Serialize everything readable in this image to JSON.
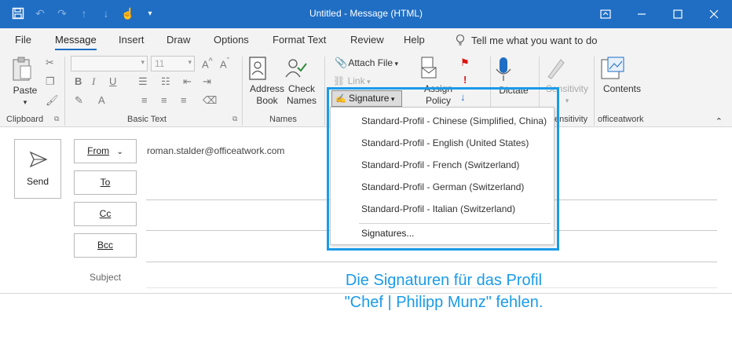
{
  "titlebar": {
    "title": "Untitled  -  Message (HTML)",
    "qat_icons": [
      "save-icon",
      "undo-icon",
      "redo-icon",
      "up-arrow-icon",
      "down-arrow-icon",
      "touch-mode-icon",
      "customize-qat-icon"
    ],
    "window_controls": [
      "ribbon-display-icon",
      "minimize-icon",
      "maximize-icon",
      "close-icon"
    ]
  },
  "tabs": [
    "File",
    "Message",
    "Insert",
    "Draw",
    "Options",
    "Format Text",
    "Review",
    "Help"
  ],
  "active_tab": "Message",
  "tell_me": "Tell me what you want to do",
  "ribbon": {
    "clipboard": {
      "paste": "Paste",
      "label": "Clipboard"
    },
    "basic_text": {
      "font_size": "11",
      "label": "Basic Text"
    },
    "names": {
      "address_book_1": "Address",
      "address_book_2": "Book",
      "check_names_1": "Check",
      "check_names_2": "Names",
      "label": "Names"
    },
    "include": {
      "attach_file": "Attach File",
      "link": "Link",
      "signature": "Signature"
    },
    "assign_policy_1": "Assign",
    "assign_policy_2": "Policy",
    "dictate": "Dictate",
    "sensitivity": "Sensitivity",
    "sensitivity_label_partial": "ensitivity",
    "contents": "Contents",
    "officeatwork_label": "officeatwork"
  },
  "compose": {
    "send": "Send",
    "from": "From",
    "from_value": "roman.stalder@officeatwork.com",
    "to": "To",
    "cc": "Cc",
    "bcc": "Bcc",
    "subject": "Subject"
  },
  "signature_menu": {
    "items": [
      "Standard-Profil - Chinese (Simplified, China)",
      "Standard-Profil - English (United States)",
      "Standard-Profil - French (Switzerland)",
      "Standard-Profil - German (Switzerland)",
      "Standard-Profil - Italian (Switzerland)"
    ],
    "signatures": "Signatures..."
  },
  "caption": {
    "line1": "Die Signaturen für das Profil",
    "line2": "\"Chef | Philipp Munz\" fehlen."
  },
  "colors": {
    "accent": "#1f6ec4",
    "highlight": "#1a9be8",
    "ribbon_bg": "#f3f3f3"
  }
}
